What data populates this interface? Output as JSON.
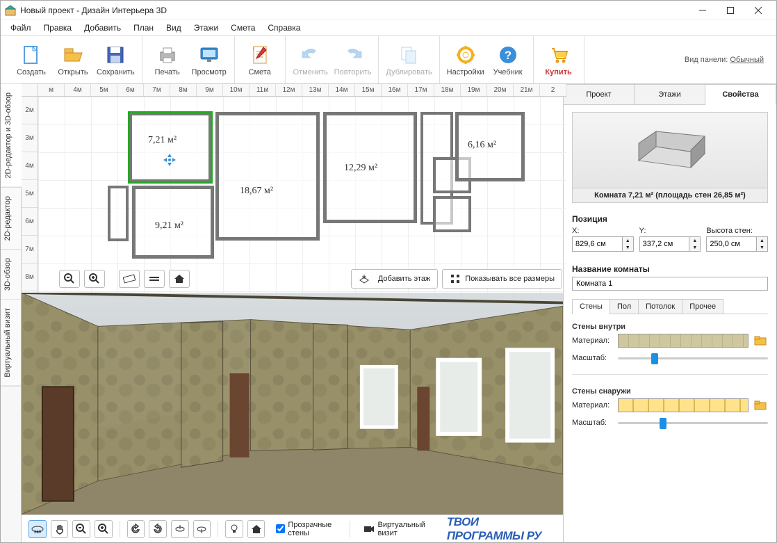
{
  "titlebar": {
    "title": "Новый проект - Дизайн Интерьера 3D"
  },
  "menu": {
    "file": "Файл",
    "edit": "Правка",
    "add": "Добавить",
    "plan": "План",
    "view": "Вид",
    "floors": "Этажи",
    "estimate": "Смета",
    "help": "Справка"
  },
  "toolbar": {
    "create": "Создать",
    "open": "Открыть",
    "save": "Сохранить",
    "print": "Печать",
    "preview": "Просмотр",
    "estimate": "Смета",
    "undo": "Отменить",
    "redo": "Повторить",
    "duplicate": "Дублировать",
    "settings": "Настройки",
    "tutorial": "Учебник",
    "buy": "Купить",
    "panelLabel": "Вид панели:",
    "panelMode": "Обычный"
  },
  "vtabs": {
    "mixed": "2D-редактор и 3D-обзор",
    "editor": "2D-редактор",
    "view3d": "3D-обзор",
    "virtual": "Виртуальный визит"
  },
  "ruler_h": [
    "м",
    "4м",
    "5м",
    "6м",
    "7м",
    "8м",
    "9м",
    "10м",
    "11м",
    "12м",
    "13м",
    "14м",
    "15м",
    "16м",
    "17м",
    "18м",
    "19м",
    "20м",
    "21м",
    "2"
  ],
  "ruler_v": [
    "2м",
    "3м",
    "4м",
    "5м",
    "6м",
    "7м",
    "8м"
  ],
  "rooms": {
    "r1": "7,21 м²",
    "r2": "18,67 м²",
    "r3": "12,29 м²",
    "r4": "6,16 м²",
    "r5": "9,21 м²"
  },
  "plan_buttons": {
    "addFloor": "Добавить этаж",
    "showSizes": "Показывать все размеры"
  },
  "bottom": {
    "transparent": "Прозрачные стены",
    "virtual": "Виртуальный визит"
  },
  "watermark": "ТВОИ ПРОГРАММЫ РУ",
  "right": {
    "tabs": {
      "project": "Проект",
      "floors": "Этажи",
      "props": "Свойства"
    },
    "previewLabel": "Комната 7,21 м²  (площадь стен 26,85 м²)",
    "position": "Позиция",
    "x": "X:",
    "y": "Y:",
    "height": "Высота стен:",
    "xVal": "829,6 см",
    "yVal": "337,2 см",
    "hVal": "250,0 см",
    "roomName": "Название комнаты",
    "roomNameVal": "Комната 1",
    "subtabs": {
      "walls": "Стены",
      "floor": "Пол",
      "ceiling": "Потолок",
      "other": "Прочее"
    },
    "wallsInside": "Стены внутри",
    "wallsOutside": "Стены снаружи",
    "material": "Материал:",
    "scale": "Масштаб:"
  }
}
